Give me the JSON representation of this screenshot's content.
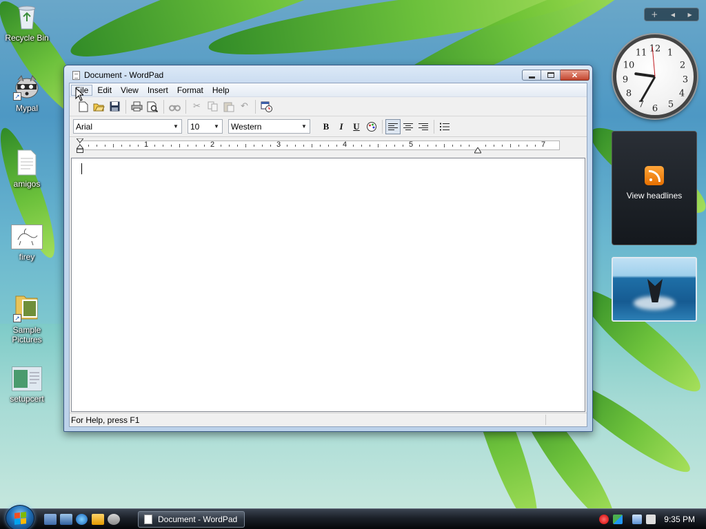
{
  "desktop": {
    "icons": [
      {
        "label": "Recycle Bin",
        "icon": "recycle-bin-icon"
      },
      {
        "label": "Mypal",
        "icon": "raccoon-app-icon"
      },
      {
        "label": "amigos",
        "icon": "text-file-icon"
      },
      {
        "label": "firey",
        "icon": "drawing-image-icon"
      },
      {
        "label": "Sample Pictures",
        "icon": "pictures-folder-icon"
      },
      {
        "label": "setupcert",
        "icon": "setup-window-icon"
      }
    ]
  },
  "sidebar": {
    "controls": [
      "+",
      "◀",
      "▶"
    ],
    "clock": {
      "hour": 9,
      "minute": 35
    },
    "feed": {
      "label": "View headlines"
    }
  },
  "window": {
    "title": "Document - WordPad",
    "menu": [
      "File",
      "Edit",
      "View",
      "Insert",
      "Format",
      "Help"
    ],
    "active_menu": "File",
    "toolbar_icons": [
      "new-icon",
      "open-icon",
      "save-icon",
      "print-icon",
      "print-preview-icon",
      "find-icon",
      "cut-icon",
      "copy-icon",
      "paste-icon",
      "undo-icon",
      "insert-date-time-icon"
    ],
    "format": {
      "font": "Arial",
      "size": "10",
      "script": "Western",
      "bold": "B",
      "italic": "I",
      "underline": "U"
    },
    "ruler_labels": [
      "1",
      "2",
      "3",
      "4",
      "5",
      "7"
    ],
    "status": "For Help, press F1"
  },
  "taskbar": {
    "task_label": "Document - WordPad",
    "time": "9:35 PM"
  }
}
